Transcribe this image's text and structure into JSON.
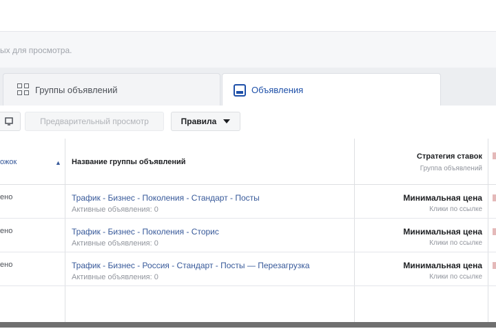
{
  "infobar": {
    "message": "ых для просмотра."
  },
  "tabs": [
    {
      "label": "Группы объявлений",
      "icon": "ad-sets-grid-icon",
      "active": false
    },
    {
      "label": "Объявления",
      "icon": "ads-icon",
      "active": true
    }
  ],
  "toolbar": {
    "edit_icon": "edit-icon",
    "preview_label": "Предварительный просмотр",
    "rules_label": "Правила"
  },
  "table": {
    "headers": {
      "first": "ожок",
      "name": "Название группы объявлений",
      "bid": "Стратегия ставок",
      "bid_sub": "Группа объявлений"
    },
    "rows": [
      {
        "status": "ено",
        "name": "Трафик - Бизнес - Поколения - Стандарт - Посты",
        "active": "Активные объявления: 0",
        "bid": "Минимальная цена",
        "bid_sub": "Клики по ссылке"
      },
      {
        "status": "ено",
        "name": "Трафик - Бизнес - Поколения - Сторис",
        "active": "Активные объявления: 0",
        "bid": "Минимальная цена",
        "bid_sub": "Клики по ссылке"
      },
      {
        "status": "ено",
        "name": "Трафик - Бизнес - Россия - Стандарт - Посты — Перезагрузка",
        "active": "Активные объявления: 0",
        "bid": "Минимальная цена",
        "bid_sub": "Клики по ссылке"
      }
    ]
  },
  "colors": {
    "link": "#365899",
    "active_tab": "#1d4fa8"
  }
}
